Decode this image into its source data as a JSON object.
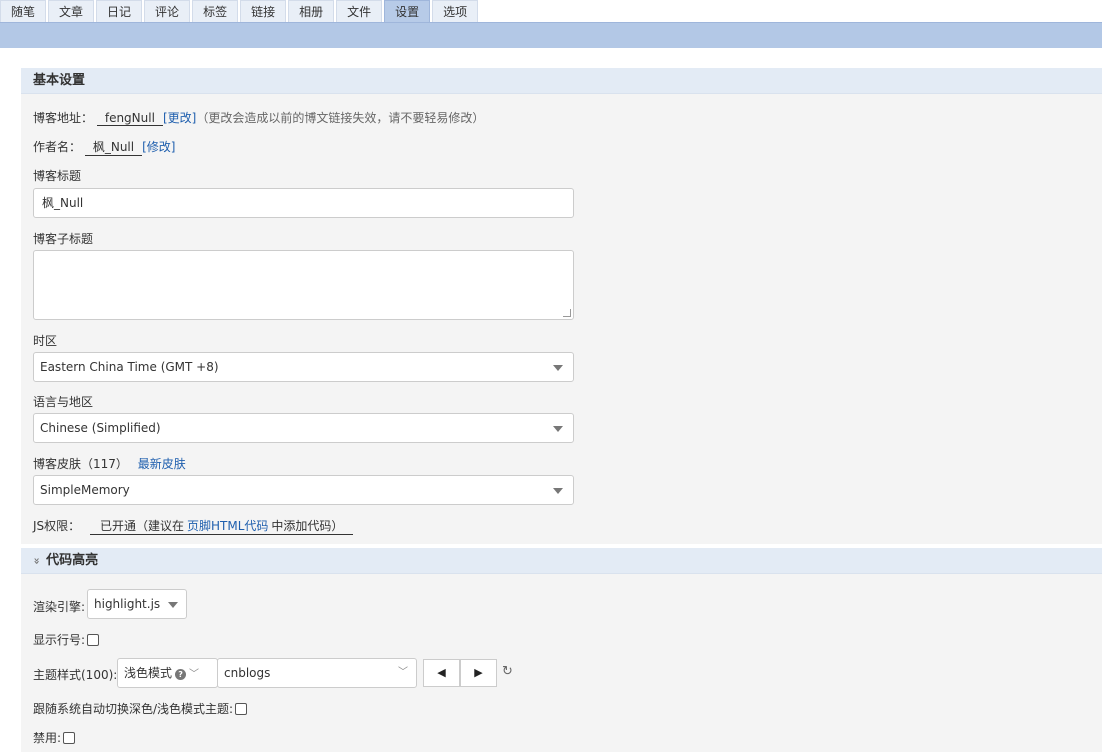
{
  "tabs": [
    "随笔",
    "文章",
    "日记",
    "评论",
    "标签",
    "链接",
    "相册",
    "文件",
    "设置",
    "选项"
  ],
  "basic": {
    "title": "基本设置",
    "blog_address_label": "博客地址：",
    "blog_address_value": "fengNull",
    "blog_address_change": "[更改]",
    "blog_address_note": "（更改会造成以前的博文链接失效，请不要轻易修改）",
    "author_label": "作者名：",
    "author_value": "枫_Null",
    "author_change": "[修改]",
    "blog_title_label": "博客标题",
    "blog_title_value": "枫_Null",
    "subtitle_label": "博客子标题",
    "subtitle_value": "",
    "timezone_label": "时区",
    "timezone_value": "Eastern China Time (GMT +8)",
    "language_label": "语言与地区",
    "language_value": "Chinese (Simplified)",
    "skin_label": "博客皮肤（117）",
    "skin_link": "最新皮肤",
    "skin_value": "SimpleMemory",
    "js_label": "JS权限：",
    "js_status": "已开通（建议在",
    "js_link": "页脚HTML代码",
    "js_tail": "中添加代码）"
  },
  "code": {
    "title": "代码高亮",
    "engine_label": "渲染引擎:",
    "engine_value": "highlight.js",
    "line_numbers_label": "显示行号:",
    "theme_label": "主题样式(100):",
    "theme_mode": "浅色模式",
    "theme_value": "cnblogs",
    "follow_system_label": "跟随系统自动切换深色/浅色模式主题:",
    "disable_label": "禁用:"
  },
  "icons": {
    "prev": "◀",
    "next": "▶",
    "refresh": "↻",
    "collapse": "»",
    "help": "?",
    "chevron": "﹀"
  }
}
